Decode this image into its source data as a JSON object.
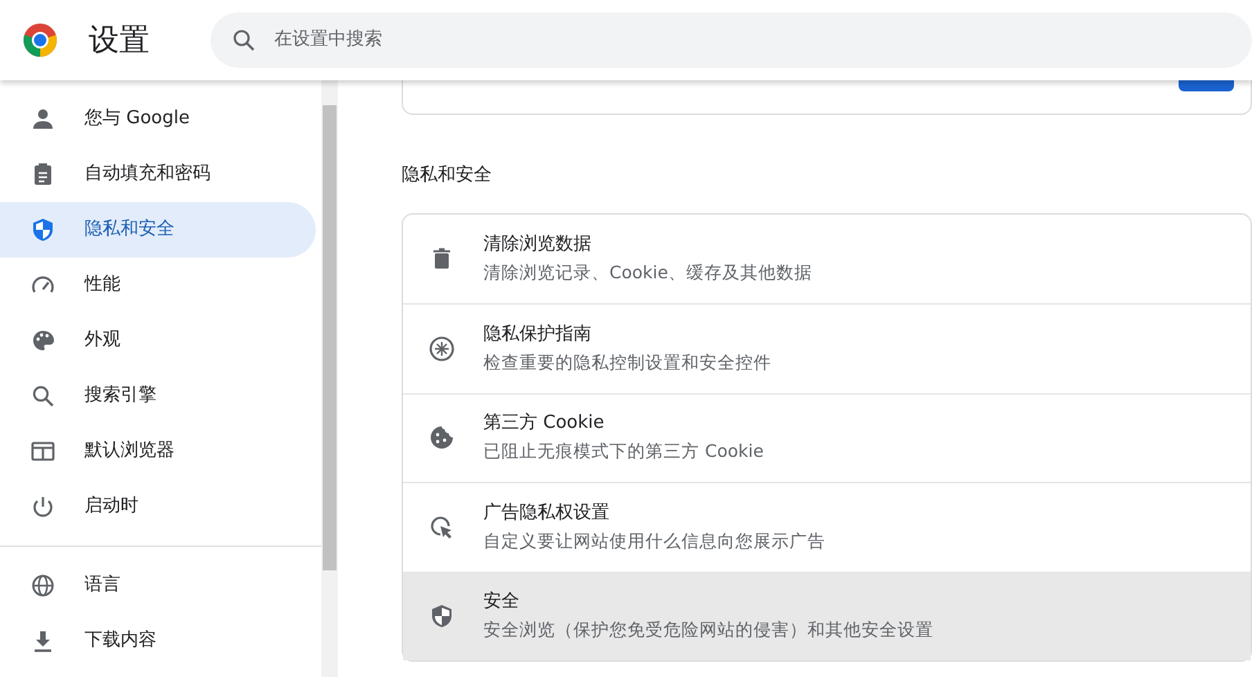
{
  "header": {
    "title": "设置",
    "search": {
      "placeholder": "在设置中搜索"
    }
  },
  "sidebar": {
    "items": [
      {
        "kind": "item",
        "label": "您与 Google",
        "selected": false
      },
      {
        "kind": "item",
        "label": "自动填充和密码",
        "selected": false
      },
      {
        "kind": "item",
        "label": "隐私和安全",
        "selected": true
      },
      {
        "kind": "item",
        "label": "性能",
        "selected": false
      },
      {
        "kind": "item",
        "label": "外观",
        "selected": false
      },
      {
        "kind": "item",
        "label": "搜索引擎",
        "selected": false
      },
      {
        "kind": "item",
        "label": "默认浏览器",
        "selected": false
      },
      {
        "kind": "item",
        "label": "启动时",
        "selected": false
      },
      {
        "kind": "divider"
      },
      {
        "kind": "item",
        "label": "语言",
        "selected": false
      },
      {
        "kind": "item",
        "label": "下载内容",
        "selected": false
      }
    ]
  },
  "section": {
    "title": "隐私和安全",
    "rows": [
      {
        "title": "清除浏览数据",
        "subtitle": "清除浏览记录、Cookie、缓存及其他数据",
        "hovered": false
      },
      {
        "title": "隐私保护指南",
        "subtitle": "检查重要的隐私控制设置和安全控件",
        "hovered": false
      },
      {
        "title": "第三方 Cookie",
        "subtitle": "已阻止无痕模式下的第三方 Cookie",
        "hovered": false
      },
      {
        "title": "广告隐私权设置",
        "subtitle": "自定义要让网站使用什么信息向您展示广告",
        "hovered": false
      },
      {
        "title": "安全",
        "subtitle": "安全浏览（保护您免受危险网站的侵害）和其他安全设置",
        "hovered": true
      }
    ]
  }
}
